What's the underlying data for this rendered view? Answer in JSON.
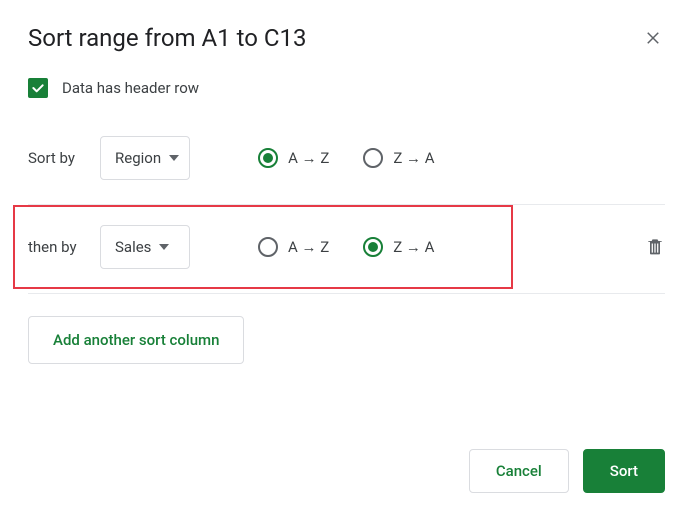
{
  "title": "Sort range from A1 to C13",
  "header_checkbox": {
    "checked": true,
    "label": "Data has header row"
  },
  "radios": {
    "asc": "A → Z",
    "desc": "Z → A"
  },
  "rows": [
    {
      "label": "Sort by",
      "column": "Region",
      "direction": "asc"
    },
    {
      "label": "then by",
      "column": "Sales",
      "direction": "desc"
    }
  ],
  "add_column_label": "Add another sort column",
  "footer": {
    "cancel": "Cancel",
    "sort": "Sort"
  }
}
